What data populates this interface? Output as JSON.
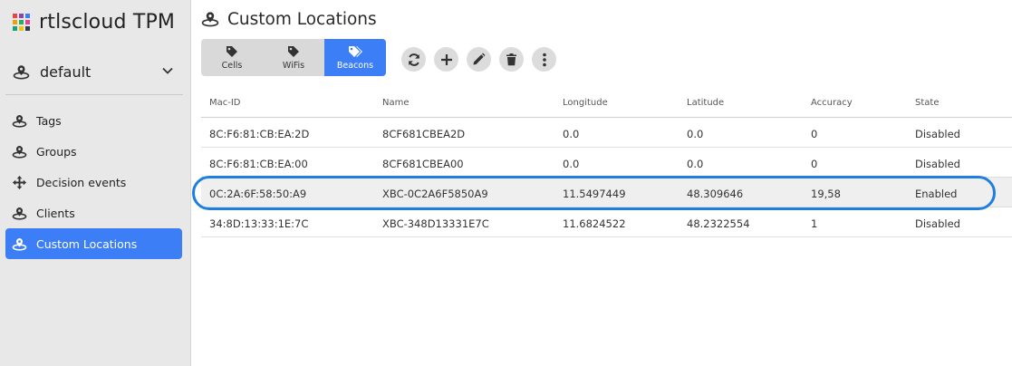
{
  "brand": {
    "name": "rtlscloud TPM",
    "logo_colors": [
      "#e8453c",
      "#8e44ad",
      "#3b7ef6",
      "#f39c12",
      "#27ae60",
      "#e84393",
      "#16a085",
      "#f1c40f",
      "#2c3e50"
    ]
  },
  "tenant": {
    "label": "default",
    "icon": "location-pin-icon",
    "chevron": "chevron-down-icon"
  },
  "sidebar": {
    "items": [
      {
        "label": "Tags",
        "icon": "location-pin-icon"
      },
      {
        "label": "Groups",
        "icon": "location-pin-icon"
      },
      {
        "label": "Decision events",
        "icon": "move-arrows-icon"
      },
      {
        "label": "Clients",
        "icon": "location-pin-icon"
      },
      {
        "label": "Custom Locations",
        "icon": "location-pin-icon",
        "active": true
      }
    ]
  },
  "page": {
    "title": "Custom Locations",
    "icon": "location-pin-icon"
  },
  "segments": [
    {
      "label": "Cells",
      "icon": "tag-icon"
    },
    {
      "label": "WiFis",
      "icon": "tag-icon"
    },
    {
      "label": "Beacons",
      "icon": "tags-icon",
      "active": true
    }
  ],
  "toolbar": [
    "refresh-icon",
    "plus-icon",
    "pencil-icon",
    "trash-icon",
    "more-vertical-icon"
  ],
  "table": {
    "columns": [
      "Mac-ID",
      "Name",
      "Longitude",
      "Latitude",
      "Accuracy",
      "State"
    ],
    "rows": [
      [
        "8C:F6:81:CB:EA:2D",
        "8CF681CBEA2D",
        "0.0",
        "0.0",
        "0",
        "Disabled"
      ],
      [
        "8C:F6:81:CB:EA:00",
        "8CF681CBEA00",
        "0.0",
        "0.0",
        "0",
        "Disabled"
      ],
      [
        "0C:2A:6F:58:50:A9",
        "XBC-0C2A6F5850A9",
        "11.5497449",
        "48.309646",
        "19,58",
        "Enabled"
      ],
      [
        "34:8D:13:33:1E:7C",
        "XBC-348D13331E7C",
        "11.6824522",
        "48.2322554",
        "1",
        "Disabled"
      ]
    ],
    "highlighted_row": 2
  },
  "colors": {
    "accent": "#3b7ef6",
    "highlight_ring": "#1f7ee0",
    "sidebar_bg": "#e8e8e8"
  }
}
